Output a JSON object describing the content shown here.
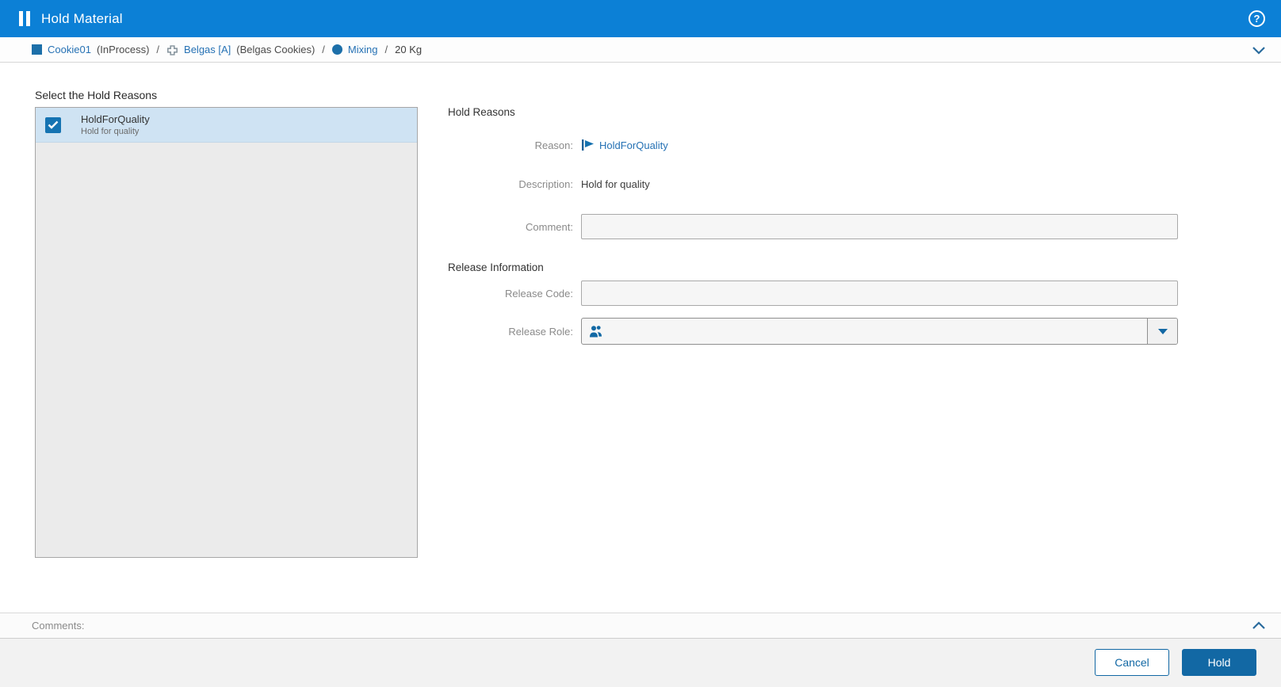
{
  "header": {
    "title": "Hold Material",
    "help_glyph": "?"
  },
  "breadcrumb": {
    "separator": "/",
    "items": [
      {
        "icon": "square-icon",
        "link": "Cookie01",
        "suffix": "(InProcess)"
      },
      {
        "icon": "product-icon",
        "link": "Belgas [A]",
        "suffix": "(Belgas Cookies)"
      },
      {
        "icon": "circle-icon",
        "link": "Mixing",
        "suffix": ""
      }
    ],
    "quantity": "20 Kg"
  },
  "hold_reasons_panel": {
    "title": "Select the Hold Reasons",
    "items": [
      {
        "name": "HoldForQuality",
        "description": "Hold for quality",
        "checked": true
      }
    ]
  },
  "form": {
    "section_hold": "Hold Reasons",
    "reason_label": "Reason:",
    "reason_value": "HoldForQuality",
    "description_label": "Description:",
    "description_value": "Hold for quality",
    "comment_label": "Comment:",
    "comment_value": "",
    "section_release": "Release Information",
    "release_code_label": "Release Code:",
    "release_code_value": "",
    "release_role_label": "Release Role:",
    "release_role_value": ""
  },
  "comments": {
    "label": "Comments:"
  },
  "footer": {
    "cancel_label": "Cancel",
    "hold_label": "Hold"
  },
  "colors": {
    "header_blue": "#0c80d6",
    "link_blue": "#2571b4",
    "action_blue": "#1268a4",
    "selection_blue": "#cfe3f3",
    "list_gray": "#ebebeb"
  }
}
